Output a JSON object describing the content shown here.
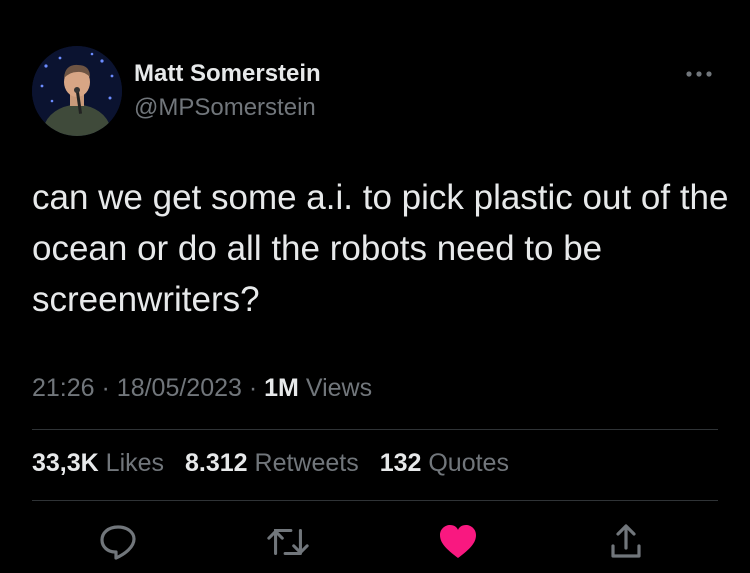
{
  "author": {
    "name": "Matt Somerstein",
    "handle": "@MPSomerstein"
  },
  "tweet": {
    "text": "can we get some a.i. to pick plastic out of the ocean or do all the robots need to be screenwriters?"
  },
  "meta": {
    "time": "21:26",
    "date": "18/05/2023",
    "views_count": "1M",
    "views_label": "Views"
  },
  "stats": {
    "likes_count": "33,3K",
    "likes_label": "Likes",
    "retweets_count": "8.312",
    "retweets_label": "Retweets",
    "quotes_count": "132",
    "quotes_label": "Quotes"
  },
  "actions": {
    "reply_icon": "reply-icon",
    "retweet_icon": "retweet-icon",
    "like_icon": "heart-icon",
    "share_icon": "share-icon",
    "like_color": "#f91880",
    "icon_color": "#71767b"
  }
}
